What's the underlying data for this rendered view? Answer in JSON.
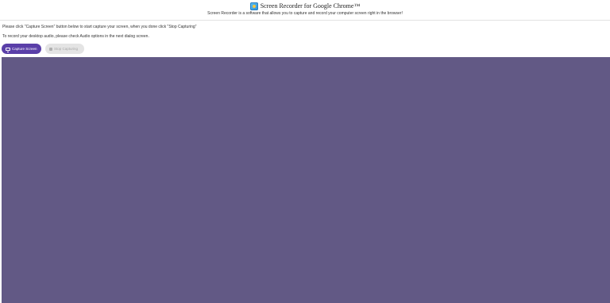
{
  "header": {
    "icon": "screen-recorder-app-icon",
    "title": "Screen Recorder for Google Chrome™",
    "subtitle": "Screen Recorder is a software that allows you to capture and record your computer screen right in the browser!"
  },
  "instructions": {
    "line1": "Please click \"Capture Screen\" button below to start capture your screen, when you done click \"Stop Capturing\"",
    "line2": "To record your desktop audio, please check Audio options in the next dialog screen."
  },
  "buttons": {
    "capture": {
      "label": "Capture Screen",
      "icon": "monitor-icon",
      "color": "#5a3fa8"
    },
    "stop": {
      "label": "Stop Capturing",
      "icon": "stop-icon",
      "disabled": true
    }
  },
  "preview": {
    "color": "#625985"
  }
}
